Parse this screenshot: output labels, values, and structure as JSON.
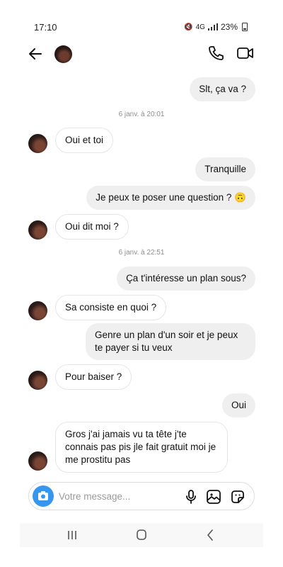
{
  "status_bar": {
    "time": "17:10",
    "signal": "4G",
    "battery": "23%"
  },
  "header": {
    "back_icon": "arrow-left-icon",
    "avatar": "contact-avatar",
    "call_icon": "phone-icon",
    "video_icon": "video-camera-icon"
  },
  "conversation": {
    "timestamps": [
      "6 janv. à 20:01",
      "6 janv. à 22:51"
    ],
    "messages": [
      {
        "from": "me",
        "text": "Slt, ça va ?"
      },
      {
        "from": "them",
        "text": "Oui et toi"
      },
      {
        "from": "me",
        "text": "Tranquille"
      },
      {
        "from": "me",
        "text": "Je peux te poser une question ? 🙃"
      },
      {
        "from": "them",
        "text": "Oui dit moi ?"
      },
      {
        "from": "me",
        "text": "Ça t'intéresse un plan sous?"
      },
      {
        "from": "them",
        "text": "Sa consiste en quoi ?"
      },
      {
        "from": "me",
        "text": "Genre un plan d'un soir et je peux te payer si tu veux"
      },
      {
        "from": "them",
        "text": "Pour baiser ?"
      },
      {
        "from": "me",
        "text": "Oui"
      },
      {
        "from": "them",
        "text": "Gros j'ai jamais vu ta tête j'te connais pas pis jle fait gratuit moi je me prostitu pas"
      }
    ]
  },
  "composer": {
    "placeholder": "Votre message...",
    "camera_icon": "camera-icon",
    "mic_icon": "microphone-icon",
    "gallery_icon": "image-icon",
    "sticker_icon": "sticker-icon"
  },
  "nav": {
    "recents_icon": "recents-icon",
    "home_icon": "home-icon",
    "back_icon": "back-icon"
  },
  "colors": {
    "accent": "#3797f0",
    "outgoing_bubble": "#efefef",
    "incoming_border": "#e5e5e5"
  }
}
